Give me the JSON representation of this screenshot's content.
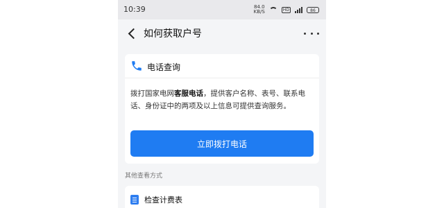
{
  "status_bar": {
    "time": "10:39",
    "net_speed_value": "84.0",
    "net_speed_unit": "KB/S",
    "hd_badge": "HD",
    "battery": "86"
  },
  "nav": {
    "title": "如何获取户号"
  },
  "phone_card": {
    "title": "电话查询",
    "desc_prefix": "拨打国家电网",
    "desc_bold": "客服电话",
    "desc_suffix": "，提供客户名称、表号、联系电话、身份证中的两项及以上信息可提供查询服务。",
    "button_label": "立即拨打电话",
    "accent_color": "#1f7cf2"
  },
  "other_methods": {
    "label": "其他查看方式",
    "items": [
      {
        "title": "检查计费表",
        "icon": "document-icon"
      }
    ]
  }
}
